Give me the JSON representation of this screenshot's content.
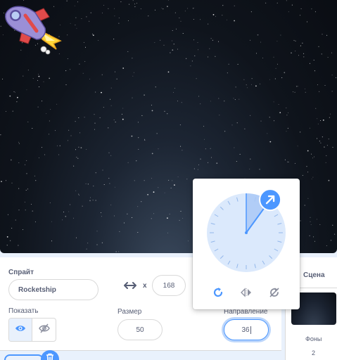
{
  "sprite_panel": {
    "sprite_label": "Спрайт",
    "sprite_name": "Rocketship",
    "x_label": "x",
    "x_value": "168",
    "show_label": "Показать",
    "size_label": "Размер",
    "size_value": "50",
    "direction_label": "Направление",
    "direction_value": "36",
    "show_state": "visible"
  },
  "direction_popover": {
    "direction_degrees": 36,
    "rotation_modes": [
      "all-around-rotation-icon",
      "left-right-rotation-icon",
      "dont-rotate-icon"
    ],
    "selected_mode": "all-around-rotation-icon"
  },
  "stage_pane": {
    "title": "Сцена",
    "backdrops_label": "Фоны",
    "backdrops_count": "2"
  },
  "colors": {
    "accent": "#4c97ff",
    "dial_fill": "#cfe1fb",
    "text": "#575e75",
    "rocket_body": "#9b8fd6",
    "rocket_fin": "#e04a4a",
    "flame": "#ffd83a"
  },
  "icons": {
    "position_arrows": "horizontal-arrows-icon",
    "show": "eye-icon",
    "hide": "eye-slash-icon",
    "delete": "trash-icon"
  }
}
